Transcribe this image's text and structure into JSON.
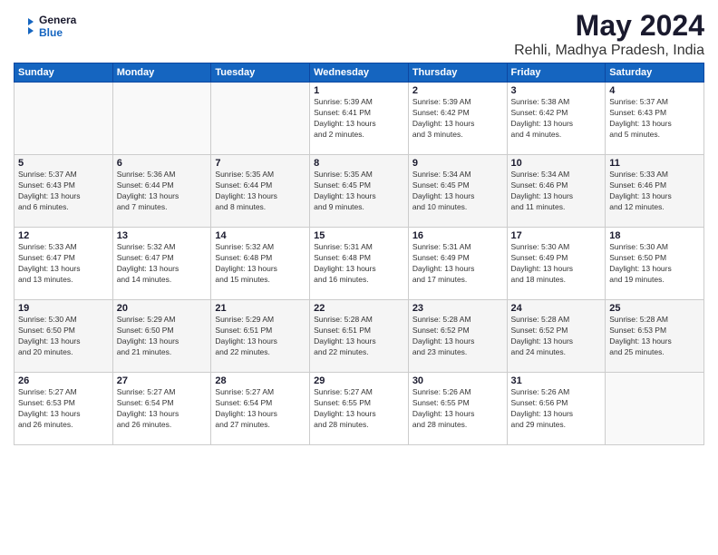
{
  "logo": {
    "line1": "General",
    "line2": "Blue"
  },
  "title": "May 2024",
  "location": "Rehli, Madhya Pradesh, India",
  "days_of_week": [
    "Sunday",
    "Monday",
    "Tuesday",
    "Wednesday",
    "Thursday",
    "Friday",
    "Saturday"
  ],
  "weeks": [
    [
      {
        "day": "",
        "info": ""
      },
      {
        "day": "",
        "info": ""
      },
      {
        "day": "",
        "info": ""
      },
      {
        "day": "1",
        "info": "Sunrise: 5:39 AM\nSunset: 6:41 PM\nDaylight: 13 hours\nand 2 minutes."
      },
      {
        "day": "2",
        "info": "Sunrise: 5:39 AM\nSunset: 6:42 PM\nDaylight: 13 hours\nand 3 minutes."
      },
      {
        "day": "3",
        "info": "Sunrise: 5:38 AM\nSunset: 6:42 PM\nDaylight: 13 hours\nand 4 minutes."
      },
      {
        "day": "4",
        "info": "Sunrise: 5:37 AM\nSunset: 6:43 PM\nDaylight: 13 hours\nand 5 minutes."
      }
    ],
    [
      {
        "day": "5",
        "info": "Sunrise: 5:37 AM\nSunset: 6:43 PM\nDaylight: 13 hours\nand 6 minutes."
      },
      {
        "day": "6",
        "info": "Sunrise: 5:36 AM\nSunset: 6:44 PM\nDaylight: 13 hours\nand 7 minutes."
      },
      {
        "day": "7",
        "info": "Sunrise: 5:35 AM\nSunset: 6:44 PM\nDaylight: 13 hours\nand 8 minutes."
      },
      {
        "day": "8",
        "info": "Sunrise: 5:35 AM\nSunset: 6:45 PM\nDaylight: 13 hours\nand 9 minutes."
      },
      {
        "day": "9",
        "info": "Sunrise: 5:34 AM\nSunset: 6:45 PM\nDaylight: 13 hours\nand 10 minutes."
      },
      {
        "day": "10",
        "info": "Sunrise: 5:34 AM\nSunset: 6:46 PM\nDaylight: 13 hours\nand 11 minutes."
      },
      {
        "day": "11",
        "info": "Sunrise: 5:33 AM\nSunset: 6:46 PM\nDaylight: 13 hours\nand 12 minutes."
      }
    ],
    [
      {
        "day": "12",
        "info": "Sunrise: 5:33 AM\nSunset: 6:47 PM\nDaylight: 13 hours\nand 13 minutes."
      },
      {
        "day": "13",
        "info": "Sunrise: 5:32 AM\nSunset: 6:47 PM\nDaylight: 13 hours\nand 14 minutes."
      },
      {
        "day": "14",
        "info": "Sunrise: 5:32 AM\nSunset: 6:48 PM\nDaylight: 13 hours\nand 15 minutes."
      },
      {
        "day": "15",
        "info": "Sunrise: 5:31 AM\nSunset: 6:48 PM\nDaylight: 13 hours\nand 16 minutes."
      },
      {
        "day": "16",
        "info": "Sunrise: 5:31 AM\nSunset: 6:49 PM\nDaylight: 13 hours\nand 17 minutes."
      },
      {
        "day": "17",
        "info": "Sunrise: 5:30 AM\nSunset: 6:49 PM\nDaylight: 13 hours\nand 18 minutes."
      },
      {
        "day": "18",
        "info": "Sunrise: 5:30 AM\nSunset: 6:50 PM\nDaylight: 13 hours\nand 19 minutes."
      }
    ],
    [
      {
        "day": "19",
        "info": "Sunrise: 5:30 AM\nSunset: 6:50 PM\nDaylight: 13 hours\nand 20 minutes."
      },
      {
        "day": "20",
        "info": "Sunrise: 5:29 AM\nSunset: 6:50 PM\nDaylight: 13 hours\nand 21 minutes."
      },
      {
        "day": "21",
        "info": "Sunrise: 5:29 AM\nSunset: 6:51 PM\nDaylight: 13 hours\nand 22 minutes."
      },
      {
        "day": "22",
        "info": "Sunrise: 5:28 AM\nSunset: 6:51 PM\nDaylight: 13 hours\nand 22 minutes."
      },
      {
        "day": "23",
        "info": "Sunrise: 5:28 AM\nSunset: 6:52 PM\nDaylight: 13 hours\nand 23 minutes."
      },
      {
        "day": "24",
        "info": "Sunrise: 5:28 AM\nSunset: 6:52 PM\nDaylight: 13 hours\nand 24 minutes."
      },
      {
        "day": "25",
        "info": "Sunrise: 5:28 AM\nSunset: 6:53 PM\nDaylight: 13 hours\nand 25 minutes."
      }
    ],
    [
      {
        "day": "26",
        "info": "Sunrise: 5:27 AM\nSunset: 6:53 PM\nDaylight: 13 hours\nand 26 minutes."
      },
      {
        "day": "27",
        "info": "Sunrise: 5:27 AM\nSunset: 6:54 PM\nDaylight: 13 hours\nand 26 minutes."
      },
      {
        "day": "28",
        "info": "Sunrise: 5:27 AM\nSunset: 6:54 PM\nDaylight: 13 hours\nand 27 minutes."
      },
      {
        "day": "29",
        "info": "Sunrise: 5:27 AM\nSunset: 6:55 PM\nDaylight: 13 hours\nand 28 minutes."
      },
      {
        "day": "30",
        "info": "Sunrise: 5:26 AM\nSunset: 6:55 PM\nDaylight: 13 hours\nand 28 minutes."
      },
      {
        "day": "31",
        "info": "Sunrise: 5:26 AM\nSunset: 6:56 PM\nDaylight: 13 hours\nand 29 minutes."
      },
      {
        "day": "",
        "info": ""
      }
    ]
  ]
}
